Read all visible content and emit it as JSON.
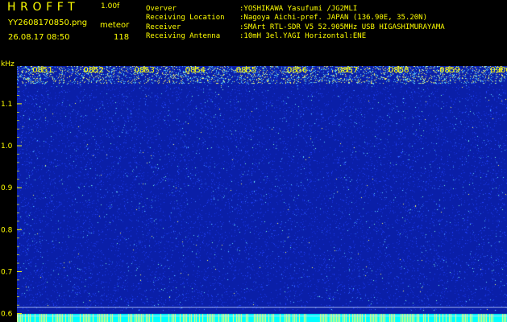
{
  "header": {
    "app_title": "HROFFT",
    "version": "1.00f",
    "filename": "YY2608170850.png",
    "meteor_label": "meteor",
    "datetime": "26.08.17 08:50",
    "meteor_count": "118"
  },
  "info": [
    {
      "label": "Overver",
      "value": ":YOSHIKAWA Yasufumi /JG2MLI"
    },
    {
      "label": "Receiving Location",
      "value": ":Nagoya Aichi-pref. JAPAN (136.90E, 35.20N)"
    },
    {
      "label": "Receiver",
      "value": ":SMArt RTL-SDR V5 52.905MHz USB HIGASHIMURAYAMA"
    },
    {
      "label": "Receiving Antenna",
      "value": ":10mH 3el.YAGI Horizontal:ENE"
    }
  ],
  "chart_data": {
    "type": "heatmap",
    "y_unit_label": "kHz",
    "x_ticks": [
      "0851",
      "0852",
      "0853",
      "0854",
      "0855",
      "0856",
      "0857",
      "0858",
      "0859",
      "0900"
    ],
    "y_ticks": [
      1.1,
      1.0,
      0.9,
      0.8,
      0.7,
      0.6
    ],
    "ylim": [
      0.58,
      1.19
    ],
    "reference_lines_khz": [
      0.615,
      0.594
    ],
    "colors": {
      "label": "#ffff00",
      "background": "#0a1fa8",
      "noise_light": "#5fd9ff",
      "noise_bright": "#ffff66",
      "bottom_band": "#00ffff"
    }
  }
}
